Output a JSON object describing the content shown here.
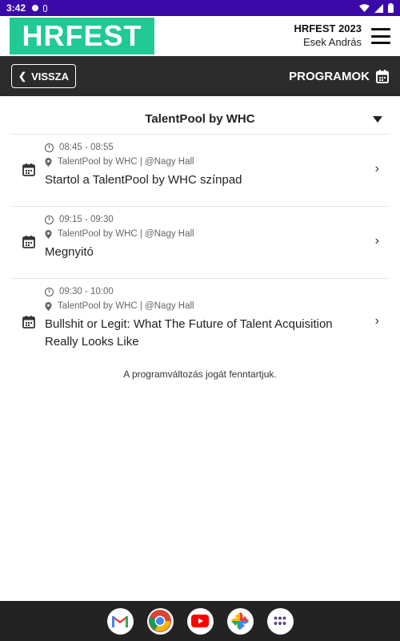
{
  "status_bar": {
    "time": "3:42"
  },
  "header": {
    "logo_text": "HRFEST",
    "event": "HRFEST 2023",
    "user": "Esek András"
  },
  "navbar": {
    "back_label": "VISSZA",
    "title": "PROGRAMOK"
  },
  "filter": {
    "selected": "TalentPool by WHC"
  },
  "programs": [
    {
      "time": "08:45 - 08:55",
      "location": "TalentPool by WHC | @Nagy Hall",
      "title": "Startol a TalentPool by WHC színpad"
    },
    {
      "time": "09:15 - 09:30",
      "location": "TalentPool by WHC | @Nagy Hall",
      "title": "Megnyitó"
    },
    {
      "time": "09:30 - 10:00",
      "location": "TalentPool by WHC | @Nagy Hall",
      "title": "Bullshit or Legit: What The Future of Talent Acquisition Really Looks Like"
    }
  ],
  "note": "A programváltozás jogát fenntartjuk.",
  "dock": {
    "apps": [
      "gmail-icon",
      "chrome-icon",
      "youtube-icon",
      "photos-icon",
      "app-drawer-icon"
    ]
  },
  "colors": {
    "status_bar": "#3b09a8",
    "brand": "#21c994",
    "navbar": "#2b2b2b",
    "dock": "#232323"
  }
}
